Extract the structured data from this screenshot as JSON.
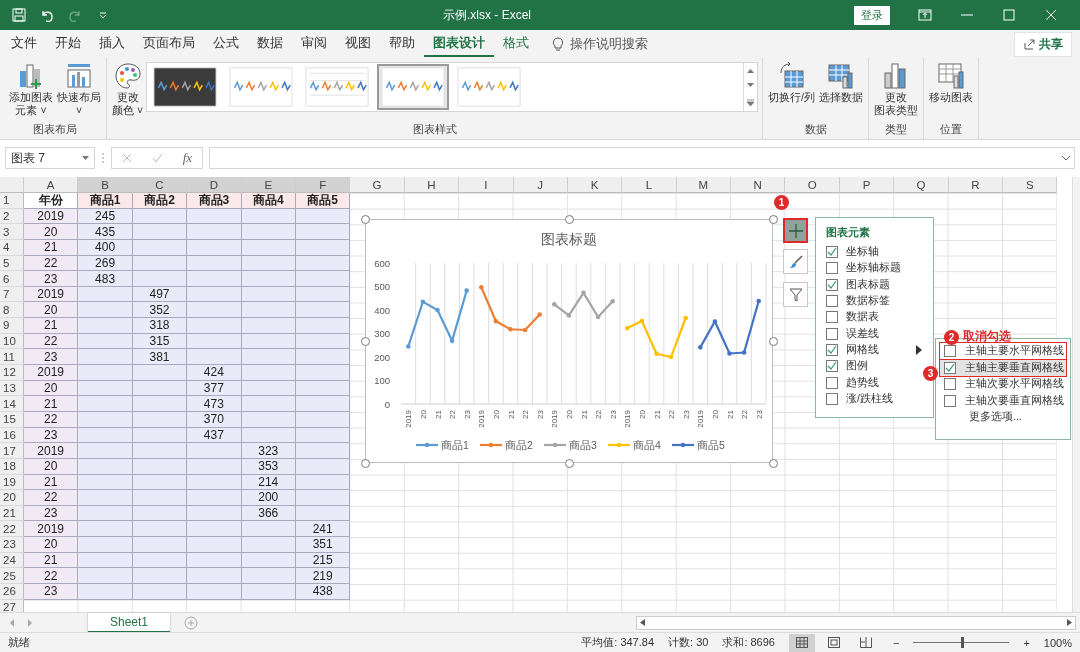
{
  "title_bar": {
    "title": "示例.xlsx - Excel",
    "sign_in": "登录",
    "redo_disabled": true
  },
  "menu_tabs": [
    {
      "label": "文件",
      "selected": false,
      "contextual": false
    },
    {
      "label": "开始",
      "selected": false,
      "contextual": false
    },
    {
      "label": "插入",
      "selected": false,
      "contextual": false
    },
    {
      "label": "页面布局",
      "selected": false,
      "contextual": false
    },
    {
      "label": "公式",
      "selected": false,
      "contextual": false
    },
    {
      "label": "数据",
      "selected": false,
      "contextual": false
    },
    {
      "label": "审阅",
      "selected": false,
      "contextual": false
    },
    {
      "label": "视图",
      "selected": false,
      "contextual": false
    },
    {
      "label": "帮助",
      "selected": false,
      "contextual": false
    },
    {
      "label": "图表设计",
      "selected": true,
      "contextual": true
    },
    {
      "label": "格式",
      "selected": false,
      "contextual": true
    }
  ],
  "search": {
    "placeholder": "操作说明搜索"
  },
  "share": "共享",
  "ribbon": {
    "groups": [
      {
        "label": "图表布局",
        "buttons": [
          {
            "lines": [
              "添加图表",
              "元素"
            ],
            "caret": "˅",
            "kind": "add-element"
          },
          {
            "lines": [
              "快速布局"
            ],
            "caret": "˅",
            "kind": "quick-layout"
          }
        ]
      },
      {
        "label": "图表样式",
        "buttons": [
          {
            "lines": [
              "更改",
              "颜色"
            ],
            "caret": "˅",
            "kind": "palette"
          }
        ],
        "gallery": [
          {
            "kind": "dark",
            "selected": false
          },
          {
            "kind": "light",
            "selected": false
          },
          {
            "kind": "grid",
            "selected": false
          },
          {
            "kind": "plain",
            "selected": true
          },
          {
            "kind": "plain",
            "selected": false
          }
        ]
      },
      {
        "label": "数据",
        "buttons": [
          {
            "lines": [
              "切换行/列"
            ],
            "kind": "switch"
          },
          {
            "lines": [
              "选择数据"
            ],
            "kind": "select-data"
          }
        ]
      },
      {
        "label": "类型",
        "buttons": [
          {
            "lines": [
              "更改",
              "图表类型"
            ],
            "kind": "chart-type"
          }
        ]
      },
      {
        "label": "位置",
        "buttons": [
          {
            "lines": [
              "移动图表"
            ],
            "kind": "move-chart"
          }
        ]
      }
    ]
  },
  "formula_bar": {
    "name_box": "图表 7",
    "fx": "fx"
  },
  "sheet": {
    "columns": [
      {
        "letter": "A",
        "selected": false
      },
      {
        "letter": "B",
        "selected": true
      },
      {
        "letter": "C",
        "selected": true
      },
      {
        "letter": "D",
        "selected": true
      },
      {
        "letter": "E",
        "selected": true
      },
      {
        "letter": "F",
        "selected": true
      },
      {
        "letter": "G",
        "selected": false
      },
      {
        "letter": "H",
        "selected": false
      },
      {
        "letter": "I",
        "selected": false
      },
      {
        "letter": "J",
        "selected": false
      },
      {
        "letter": "K",
        "selected": false
      },
      {
        "letter": "L",
        "selected": false
      },
      {
        "letter": "M",
        "selected": false
      },
      {
        "letter": "N",
        "selected": false
      },
      {
        "letter": "O",
        "selected": false
      },
      {
        "letter": "P",
        "selected": false
      },
      {
        "letter": "Q",
        "selected": false
      },
      {
        "letter": "R",
        "selected": false
      },
      {
        "letter": "S",
        "selected": false
      }
    ],
    "rows": [
      {
        "number": "1",
        "cells": {
          "A": "年份",
          "B": "商品1",
          "C": "商品2",
          "D": "商品3",
          "E": "商品4",
          "F": "商品5"
        }
      },
      {
        "number": "2",
        "cells": {
          "A": "2019",
          "B": "245"
        }
      },
      {
        "number": "3",
        "cells": {
          "A": "20",
          "B": "435"
        }
      },
      {
        "number": "4",
        "cells": {
          "A": "21",
          "B": "400"
        }
      },
      {
        "number": "5",
        "cells": {
          "A": "22",
          "B": "269"
        }
      },
      {
        "number": "6",
        "cells": {
          "A": "23",
          "B": "483"
        }
      },
      {
        "number": "7",
        "cells": {
          "A": "2019",
          "C": "497"
        }
      },
      {
        "number": "8",
        "cells": {
          "A": "20",
          "C": "352"
        }
      },
      {
        "number": "9",
        "cells": {
          "A": "21",
          "C": "318"
        }
      },
      {
        "number": "10",
        "cells": {
          "A": "22",
          "C": "315"
        }
      },
      {
        "number": "11",
        "cells": {
          "A": "23",
          "C": "381"
        }
      },
      {
        "number": "12",
        "cells": {
          "A": "2019",
          "D": "424"
        }
      },
      {
        "number": "13",
        "cells": {
          "A": "20",
          "D": "377"
        }
      },
      {
        "number": "14",
        "cells": {
          "A": "21",
          "D": "473"
        }
      },
      {
        "number": "15",
        "cells": {
          "A": "22",
          "D": "370"
        }
      },
      {
        "number": "16",
        "cells": {
          "A": "23",
          "D": "437"
        }
      },
      {
        "number": "17",
        "cells": {
          "A": "2019",
          "E": "323"
        }
      },
      {
        "number": "18",
        "cells": {
          "A": "20",
          "E": "353"
        }
      },
      {
        "number": "19",
        "cells": {
          "A": "21",
          "E": "214"
        }
      },
      {
        "number": "20",
        "cells": {
          "A": "22",
          "E": "200"
        }
      },
      {
        "number": "21",
        "cells": {
          "A": "23",
          "E": "366"
        }
      },
      {
        "number": "22",
        "cells": {
          "A": "2019",
          "F": "241"
        }
      },
      {
        "number": "23",
        "cells": {
          "A": "20",
          "F": "351"
        }
      },
      {
        "number": "24",
        "cells": {
          "A": "21",
          "F": "215"
        }
      },
      {
        "number": "25",
        "cells": {
          "A": "22",
          "F": "219"
        }
      },
      {
        "number": "26",
        "cells": {
          "A": "23",
          "F": "438"
        }
      },
      {
        "number": "27"
      }
    ]
  },
  "chart": {
    "chart_data": {
      "type": "line",
      "title": "图表标题",
      "categories": [
        "2019",
        "20",
        "21",
        "22",
        "23",
        "2019",
        "20",
        "21",
        "22",
        "23",
        "2019",
        "20",
        "21",
        "22",
        "23",
        "2019",
        "20",
        "21",
        "22",
        "23",
        "2019",
        "20",
        "21",
        "22",
        "23"
      ],
      "series": [
        {
          "name": "商品1",
          "color": "#5b9bd5",
          "values": [
            245,
            435,
            400,
            269,
            483,
            null,
            null,
            null,
            null,
            null,
            null,
            null,
            null,
            null,
            null,
            null,
            null,
            null,
            null,
            null,
            null,
            null,
            null,
            null,
            null
          ]
        },
        {
          "name": "商品2",
          "color": "#ed7d31",
          "values": [
            null,
            null,
            null,
            null,
            null,
            497,
            352,
            318,
            315,
            381,
            null,
            null,
            null,
            null,
            null,
            null,
            null,
            null,
            null,
            null,
            null,
            null,
            null,
            null,
            null
          ]
        },
        {
          "name": "商品3",
          "color": "#a5a5a5",
          "values": [
            null,
            null,
            null,
            null,
            null,
            null,
            null,
            null,
            null,
            null,
            424,
            377,
            473,
            370,
            437,
            null,
            null,
            null,
            null,
            null,
            null,
            null,
            null,
            null,
            null
          ]
        },
        {
          "name": "商品4",
          "color": "#ffc000",
          "values": [
            null,
            null,
            null,
            null,
            null,
            null,
            null,
            null,
            null,
            null,
            null,
            null,
            null,
            null,
            null,
            323,
            353,
            214,
            200,
            366,
            null,
            null,
            null,
            null,
            null
          ]
        },
        {
          "name": "商品5",
          "color": "#4472c4",
          "values": [
            null,
            null,
            null,
            null,
            null,
            null,
            null,
            null,
            null,
            null,
            null,
            null,
            null,
            null,
            null,
            null,
            null,
            null,
            null,
            null,
            241,
            351,
            215,
            219,
            438
          ]
        }
      ],
      "ylim": [
        0,
        600
      ],
      "yticks": [
        {
          "value": 0,
          "label": "0"
        },
        {
          "value": 100,
          "label": "100"
        },
        {
          "value": 200,
          "label": "200"
        },
        {
          "value": 300,
          "label": "300"
        },
        {
          "value": 400,
          "label": "400"
        },
        {
          "value": 500,
          "label": "500"
        },
        {
          "value": 600,
          "label": "600"
        }
      ],
      "legend": "bottom"
    }
  },
  "chart_elements": {
    "title": "图表元素",
    "items": [
      {
        "label": "坐标轴",
        "checked": true,
        "submenu": false
      },
      {
        "label": "坐标轴标题",
        "checked": false,
        "submenu": false
      },
      {
        "label": "图表标题",
        "checked": true,
        "submenu": false
      },
      {
        "label": "数据标签",
        "checked": false,
        "submenu": false
      },
      {
        "label": "数据表",
        "checked": false,
        "submenu": false
      },
      {
        "label": "误差线",
        "checked": false,
        "submenu": false
      },
      {
        "label": "网格线",
        "checked": true,
        "submenu": true
      },
      {
        "label": "图例",
        "checked": true,
        "submenu": false
      },
      {
        "label": "趋势线",
        "checked": false,
        "submenu": false
      },
      {
        "label": "涨/跌柱线",
        "checked": false,
        "submenu": false
      }
    ]
  },
  "gridlines_menu": {
    "items": [
      {
        "kind": "checkbox",
        "label": "主轴主要水平网格线",
        "checked": false,
        "highlighted": false,
        "outlined": true
      },
      {
        "kind": "checkbox",
        "label": "主轴主要垂直网格线",
        "checked": true,
        "highlighted": true,
        "outlined": true
      },
      {
        "kind": "checkbox",
        "label": "主轴次要水平网格线",
        "checked": false,
        "highlighted": false,
        "outlined": false
      },
      {
        "kind": "checkbox",
        "label": "主轴次要垂直网格线",
        "checked": false,
        "highlighted": false,
        "outlined": false
      },
      {
        "kind": "command",
        "label": "更多选项..."
      }
    ]
  },
  "annotations": [
    {
      "number": "1"
    },
    {
      "number": "2",
      "note": "取消勾选"
    },
    {
      "number": "3"
    }
  ],
  "sheet_tabs": [
    {
      "label": "Sheet1",
      "selected": true
    }
  ],
  "status_bar": {
    "ready": "就绪",
    "stats": [
      "平均值: 347.84",
      "计数: 30",
      "求和: 8696"
    ],
    "views": [
      {
        "kind": "normal",
        "selected": true
      },
      {
        "kind": "page-layout",
        "selected": false
      },
      {
        "kind": "page-break",
        "selected": false
      }
    ],
    "zoom": {
      "out": "−",
      "level": 0.5,
      "in": "+",
      "reading": "100%"
    }
  }
}
